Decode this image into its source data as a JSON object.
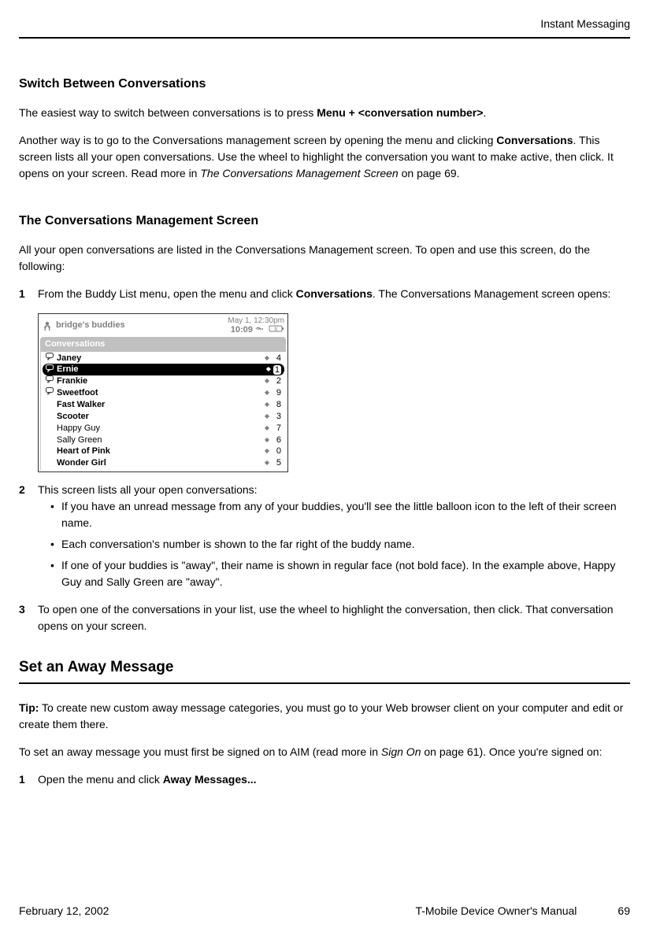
{
  "header": {
    "running_title": "Instant Messaging"
  },
  "sections": {
    "switch": {
      "heading": "Switch Between Conversations",
      "p1_prefix": "The easiest way to switch between conversations is to press ",
      "p1_bold": "Menu + <conversation number>",
      "p1_suffix": ".",
      "p2_a": "Another way is to go to the Conversations management screen by opening the menu and clicking ",
      "p2_bold": "Conversations",
      "p2_b": ". This screen lists all your open conversations. Use the wheel to highlight the conversation you want to make active, then click. It opens on your screen. Read more in ",
      "p2_italic": "The Conversations Management Screen",
      "p2_c": " on page 69."
    },
    "mgmt": {
      "heading": "The Conversations Management Screen",
      "intro": "All your open conversations are listed in the Conversations Management screen. To open and use this screen, do the following:",
      "step1_num": "1",
      "step1_a": "From the Buddy List menu, open the menu and click ",
      "step1_bold": "Conversations",
      "step1_b": ". The Conversations Management screen opens:",
      "step2_num": "2",
      "step2_text": "This screen lists all your open conversations:",
      "bullets": [
        "If you have an unread message from any of your buddies, you'll see the little balloon icon to the left of their screen name.",
        "Each conversation's number is shown to the far right of the buddy name.",
        "If one of your buddies is \"away\", their name is shown in regular face (not bold face). In the example above, Happy Guy and Sally Green are \"away\"."
      ],
      "step3_num": "3",
      "step3_text": "To open one of the conversations in your list, use the wheel to highlight the conversation, then click. That conversation opens on your screen."
    },
    "away": {
      "heading": "Set an Away Message",
      "tip_label": "Tip:",
      "tip_text": " To create new custom away message categories, you must go to your Web browser client on your computer and edit or create them there.",
      "p1_a": "To set an away message you must first be signed on to AIM (read more in ",
      "p1_italic": "Sign On",
      "p1_b": " on page 61). Once you're signed on:",
      "step1_num": "1",
      "step1_a": "Open the menu and click ",
      "step1_bold": "Away Messages..."
    }
  },
  "screenshot": {
    "title": "bridge's buddies",
    "date": "May 1, 12:30pm",
    "time": "10:09",
    "conversations_label": "Conversations",
    "rows": [
      {
        "name": "Janey",
        "num": "4",
        "bold": true,
        "speech": true,
        "selected": false
      },
      {
        "name": "Ernie",
        "num": "1",
        "bold": true,
        "speech": true,
        "selected": true
      },
      {
        "name": "Frankie",
        "num": "2",
        "bold": true,
        "speech": true,
        "selected": false
      },
      {
        "name": "Sweetfoot",
        "num": "9",
        "bold": true,
        "speech": true,
        "selected": false
      },
      {
        "name": "Fast Walker",
        "num": "8",
        "bold": true,
        "speech": false,
        "selected": false
      },
      {
        "name": "Scooter",
        "num": "3",
        "bold": true,
        "speech": false,
        "selected": false
      },
      {
        "name": "Happy Guy",
        "num": "7",
        "bold": false,
        "speech": false,
        "selected": false
      },
      {
        "name": "Sally Green",
        "num": "6",
        "bold": false,
        "speech": false,
        "selected": false
      },
      {
        "name": "Heart of Pink",
        "num": "0",
        "bold": true,
        "speech": false,
        "selected": false
      },
      {
        "name": "Wonder Girl",
        "num": "5",
        "bold": true,
        "speech": false,
        "selected": false
      }
    ]
  },
  "footer": {
    "date": "February 12, 2002",
    "title": "T-Mobile Device Owner's Manual",
    "page": "69"
  }
}
